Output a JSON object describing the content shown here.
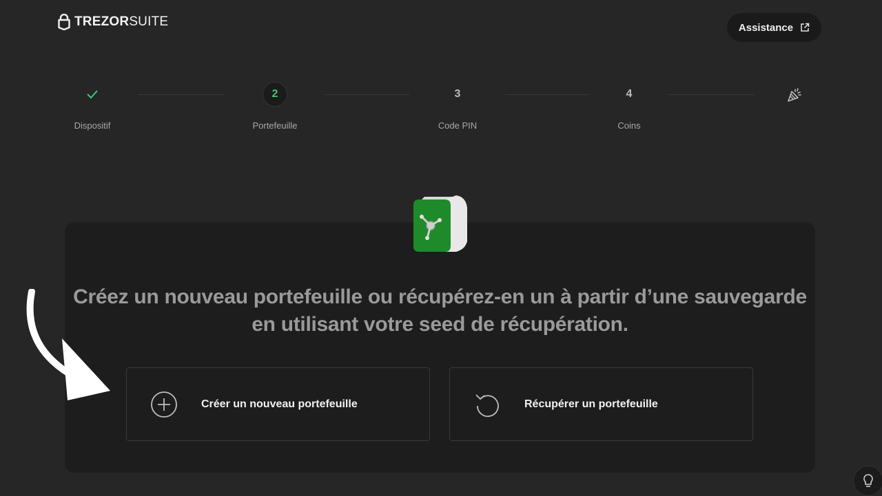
{
  "brand": {
    "name_bold": "TREZOR",
    "name_light": "SUITE"
  },
  "header": {
    "help_label": "Assistance"
  },
  "stepper": {
    "steps": [
      {
        "label": "Dispositif",
        "number": "",
        "state": "done"
      },
      {
        "label": "Portefeuille",
        "number": "2",
        "state": "active"
      },
      {
        "label": "Code PIN",
        "number": "3",
        "state": "pending"
      },
      {
        "label": "Coins",
        "number": "4",
        "state": "pending"
      }
    ],
    "final_icon": "party-popper-icon"
  },
  "main": {
    "headline": "Créez un nouveau portefeuille ou récupérez-en un à partir d’une sauvegarde en utilisant votre seed de récupération.",
    "options": [
      {
        "label": "Créer un nouveau portefeuille",
        "icon": "plus-circle-icon"
      },
      {
        "label": "Récupérer un portefeuille",
        "icon": "restore-icon"
      }
    ]
  },
  "colors": {
    "accent": "#3ec77c",
    "background": "#262626",
    "card": "#1d1d1d",
    "vault_green": "#1f8a2a"
  }
}
